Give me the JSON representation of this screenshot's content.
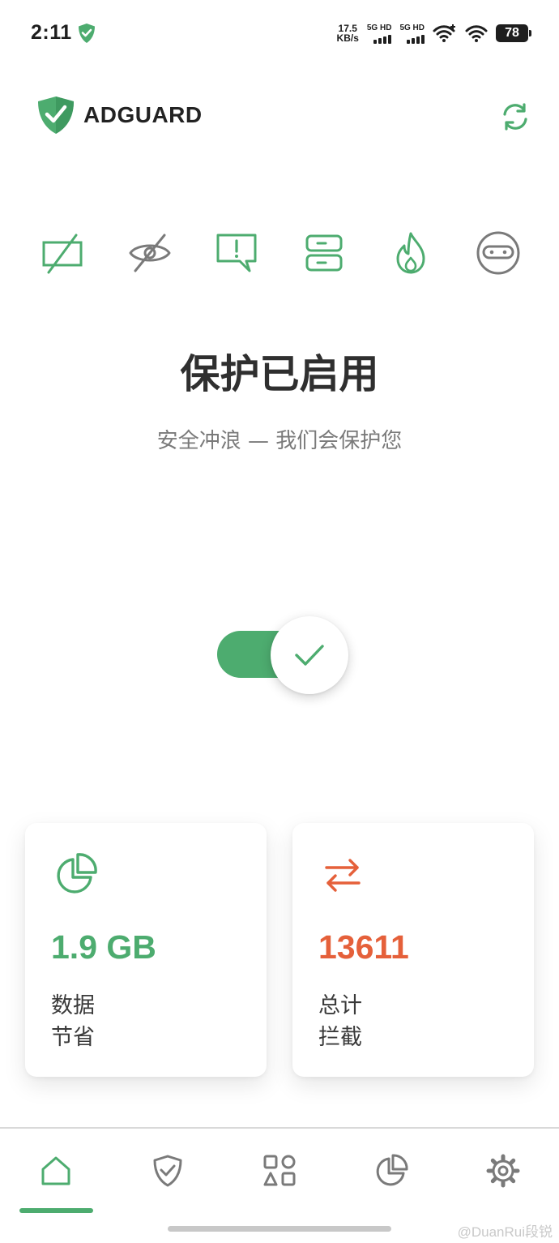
{
  "status_bar": {
    "time": "2:11",
    "net_speed_value": "17.5",
    "net_speed_unit": "KB/s",
    "sim1_label": "5G HD",
    "sim2_label": "5G HD",
    "battery": "78"
  },
  "header": {
    "brand": "ADGUARD",
    "refresh_icon": "refresh-icon"
  },
  "features": [
    {
      "name": "ad-blocking",
      "icon": "ad-block-icon"
    },
    {
      "name": "tracking-protection",
      "icon": "eye-slash-icon"
    },
    {
      "name": "annoyance-blocking",
      "icon": "alert-message-icon"
    },
    {
      "name": "dns-protection",
      "icon": "server-icon"
    },
    {
      "name": "firewall",
      "icon": "flame-icon"
    },
    {
      "name": "stealth-mode",
      "icon": "ninja-icon"
    }
  ],
  "protection": {
    "title": "保护已启用",
    "subtitle": "安全冲浪 — 我们会保护您",
    "enabled": true
  },
  "stats": [
    {
      "value": "1.9 GB",
      "label_line1": "数据",
      "label_line2": "节省",
      "icon": "pie-chart-icon",
      "color": "#4dac6f"
    },
    {
      "value": "13611",
      "label_line1": "总计",
      "label_line2": "拦截",
      "icon": "arrows-exchange-icon",
      "color": "#e5603a"
    }
  ],
  "bottom_nav": [
    {
      "id": "home",
      "icon": "home-icon",
      "active": true
    },
    {
      "id": "protection",
      "icon": "shield-check-icon",
      "active": false
    },
    {
      "id": "activity",
      "icon": "shapes-icon",
      "active": false
    },
    {
      "id": "statistics",
      "icon": "pie-chart-icon",
      "active": false
    },
    {
      "id": "settings",
      "icon": "gear-icon",
      "active": false
    }
  ],
  "watermark": "@DuanRui段锐",
  "colors": {
    "accent": "#4dac6f",
    "warning": "#e5603a",
    "inactive_icon": "#7a7a7a"
  }
}
